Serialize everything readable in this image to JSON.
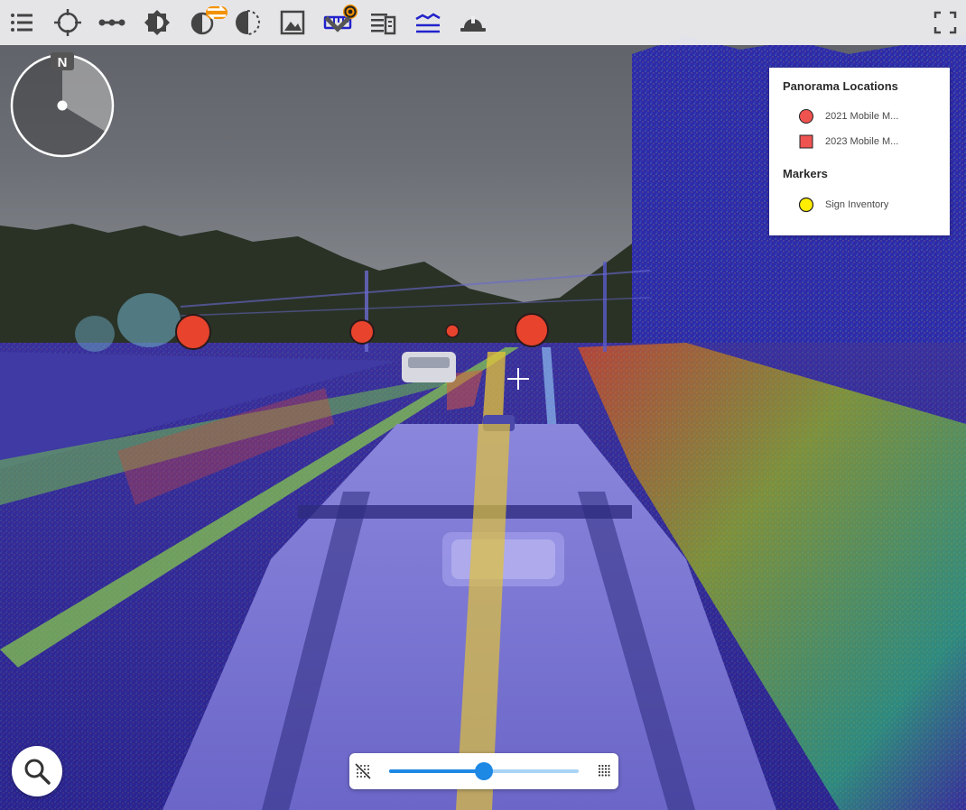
{
  "toolbar": {
    "tools": [
      {
        "name": "layers-list-icon",
        "active": false
      },
      {
        "name": "locate-crosshair-icon",
        "active": false
      },
      {
        "name": "measure-line-icon",
        "active": false
      },
      {
        "name": "brightness-icon",
        "active": false
      },
      {
        "name": "compare-swap-icon",
        "active": false,
        "badge": "⇄"
      },
      {
        "name": "contrast-half-icon",
        "active": false
      },
      {
        "name": "image-icon",
        "active": false
      },
      {
        "name": "ruler-icon",
        "active": true,
        "badge": "◉"
      },
      {
        "name": "attribute-list-icon",
        "active": false
      },
      {
        "name": "elevation-layers-icon",
        "active": true
      },
      {
        "name": "hard-hat-icon",
        "active": false
      }
    ],
    "fullscreen_icon": "fullscreen-icon",
    "accent_color": "#2222cc",
    "badge_color": "#f39200"
  },
  "compass": {
    "north_label": "N",
    "heading_deg": 120
  },
  "legend": {
    "sections": [
      {
        "title": "Panorama Locations",
        "items": [
          {
            "label": "2021 Mobile M...",
            "symbol": "circle",
            "color": "#ef5350"
          },
          {
            "label": "2023 Mobile M...",
            "symbol": "square",
            "color": "#ef5350"
          }
        ]
      },
      {
        "title": "Markers",
        "items": [
          {
            "label": "Sign Inventory",
            "symbol": "circle",
            "color": "#ffee00"
          }
        ]
      }
    ]
  },
  "search": {
    "icon": "search-icon"
  },
  "density_slider": {
    "value": 0.5,
    "low_icon": "density-off-icon",
    "high_icon": "density-high-icon",
    "color": "#1e88e5"
  },
  "scene": {
    "crosshair": "+"
  }
}
